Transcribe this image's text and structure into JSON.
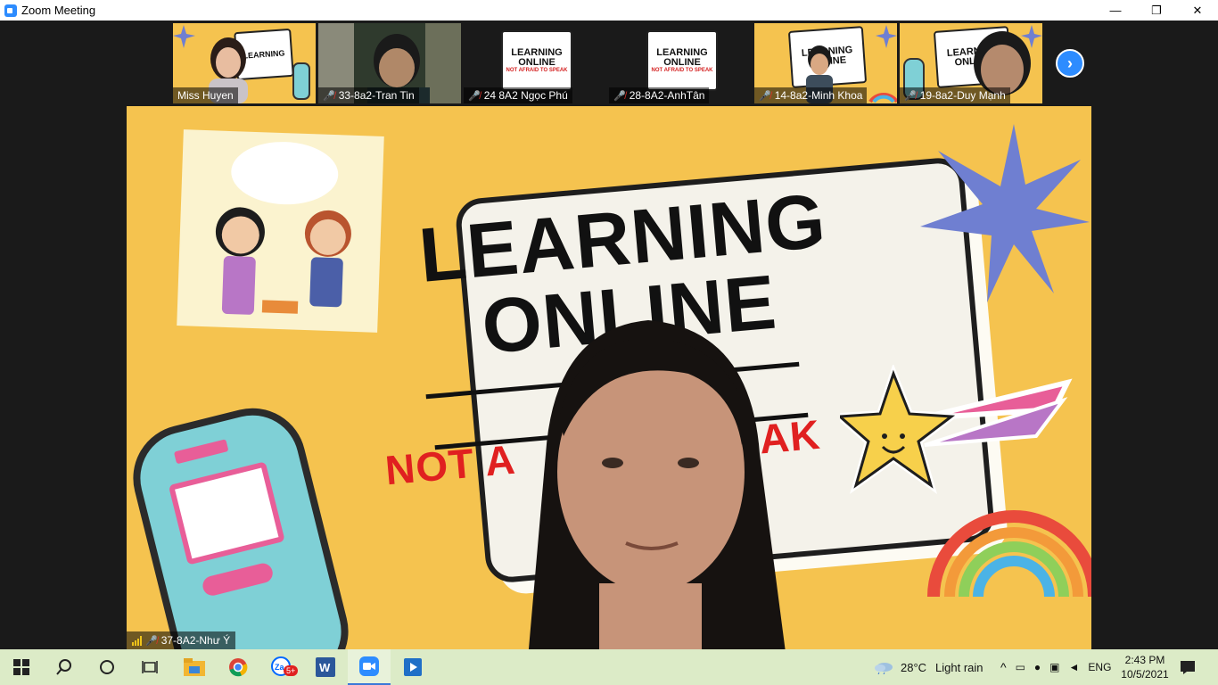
{
  "window": {
    "title": "Zoom Meeting",
    "minimize": "—",
    "restore": "❐",
    "close": "✕"
  },
  "thumbnails": [
    {
      "name": "Miss Huyen",
      "muted": false
    },
    {
      "name": "33-8a2-Tran Tin",
      "muted": true
    },
    {
      "name": "24 8A2 Ngọc Phú",
      "muted": true
    },
    {
      "name": "28-8A2-AnhTân",
      "muted": true
    },
    {
      "name": "14-8a2-Minh Khoa",
      "muted": true
    },
    {
      "name": "19-8a2-Duy Mạnh",
      "muted": true
    }
  ],
  "poster": {
    "line1": "LEARNING",
    "line2": "ONLINE",
    "subtitle_left": "NOT A",
    "subtitle_right": "EAK",
    "mini_subtitle": "NOT AFRAID TO SPEAK"
  },
  "speaker": {
    "name": "37-8A2-Như Ý"
  },
  "next_icon": "chevron-right-icon",
  "taskbar": {
    "weather_temp": "28°C",
    "weather_text": "Light rain",
    "language": "ENG",
    "time": "2:43 PM",
    "date": "10/5/2021",
    "zalo_badge": "5+"
  },
  "colors": {
    "zoom_blue": "#2d8cff",
    "poster_yellow": "#f5c34f",
    "taskbar_green": "#dcebc7",
    "accent_red": "#e02020"
  }
}
